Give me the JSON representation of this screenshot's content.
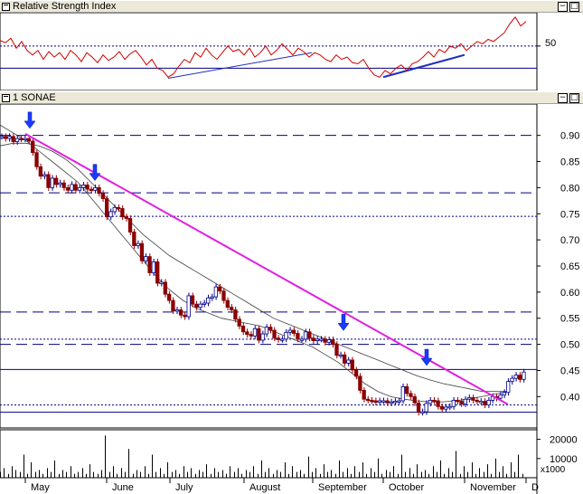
{
  "rsi_panel": {
    "title": "Relative Strength Index",
    "level_label": "50"
  },
  "price_panel": {
    "title": "1 SONAE",
    "volume_scale_label": "x1000"
  },
  "window_buttons": {
    "minimize": "−",
    "maximize": "□"
  },
  "colors": {
    "candle_up": "#00008b",
    "candle_down": "#8b0000",
    "trendline": "#e020e0",
    "signal_arrow": "#1a3cff",
    "rsi_line": "#d00000",
    "rsi_trendline": "#1f2fbf",
    "moving_average": "#404040",
    "level_line": "#000080",
    "volume_bar": "#000000"
  },
  "chart_data": [
    {
      "type": "line",
      "name": "rsi",
      "title": "Relative Strength Index",
      "ylim": [
        10,
        80
      ],
      "level_lines": [
        50,
        30
      ],
      "x": [
        0,
        6,
        12,
        18,
        24,
        30,
        36,
        42,
        48,
        54,
        60,
        66,
        72,
        78,
        84,
        90,
        96,
        102,
        108,
        114,
        120,
        126,
        132,
        138,
        144,
        150,
        156,
        162,
        168,
        174,
        180,
        186,
        192,
        198,
        204,
        210,
        216,
        222,
        228,
        234,
        240,
        246,
        252,
        258,
        264,
        270,
        276,
        282,
        288,
        294,
        300,
        306,
        312,
        318,
        324,
        330,
        336,
        342,
        348,
        354,
        360,
        366,
        372,
        378,
        384,
        390,
        396,
        402,
        408,
        414,
        420,
        426,
        432,
        438,
        444,
        450,
        456,
        462,
        468,
        474,
        480,
        486,
        492,
        498,
        504,
        510,
        516,
        522,
        528,
        534,
        540,
        546,
        552,
        558,
        564,
        570,
        576,
        582
      ],
      "values": [
        55,
        53,
        57,
        48,
        54,
        46,
        42,
        46,
        38,
        45,
        40,
        44,
        38,
        46,
        42,
        36,
        44,
        40,
        35,
        42,
        37,
        40,
        45,
        38,
        43,
        46,
        40,
        33,
        38,
        30,
        28,
        22,
        25,
        32,
        38,
        35,
        44,
        40,
        48,
        42,
        38,
        44,
        50,
        45,
        47,
        42,
        48,
        40,
        44,
        50,
        42,
        46,
        52,
        47,
        42,
        48,
        45,
        40,
        44,
        42,
        38,
        36,
        42,
        38,
        40,
        35,
        34,
        38,
        30,
        24,
        22,
        28,
        25,
        30,
        33,
        28,
        34,
        36,
        40,
        45,
        40,
        47,
        44,
        50,
        48,
        52,
        46,
        50,
        54,
        52,
        56,
        54,
        58,
        62,
        70,
        76,
        68,
        72
      ],
      "trendlines": [
        {
          "from": [
            186,
            21
          ],
          "to": [
            345,
            44
          ]
        },
        {
          "from": [
            424,
            22
          ],
          "to": [
            514,
            42
          ]
        }
      ]
    },
    {
      "type": "candlestick",
      "name": "1 SONAE",
      "title": "1 SONAE",
      "ylim": [
        0.34,
        0.96
      ],
      "yticks": [
        0.9,
        0.85,
        0.8,
        0.75,
        0.7,
        0.65,
        0.6,
        0.55,
        0.5,
        0.45,
        0.4
      ],
      "xlabels": [
        "May",
        "June",
        "July",
        "August",
        "September",
        "October",
        "November",
        "D"
      ],
      "month_x": [
        28,
        118,
        188,
        270,
        346,
        424,
        514,
        582
      ],
      "close": [
        0.898,
        0.894,
        0.898,
        0.888,
        0.894,
        0.893,
        0.894,
        0.889,
        0.867,
        0.84,
        0.822,
        0.825,
        0.8,
        0.818,
        0.806,
        0.809,
        0.8,
        0.795,
        0.806,
        0.795,
        0.8,
        0.805,
        0.797,
        0.795,
        0.8,
        0.789,
        0.779,
        0.744,
        0.754,
        0.762,
        0.76,
        0.744,
        0.741,
        0.715,
        0.689,
        0.693,
        0.66,
        0.668,
        0.637,
        0.658,
        0.617,
        0.619,
        0.596,
        0.584,
        0.564,
        0.566,
        0.556,
        0.553,
        0.593,
        0.577,
        0.571,
        0.577,
        0.579,
        0.589,
        0.591,
        0.61,
        0.602,
        0.584,
        0.571,
        0.566,
        0.548,
        0.535,
        0.524,
        0.519,
        0.516,
        0.53,
        0.508,
        0.52,
        0.533,
        0.527,
        0.512,
        0.509,
        0.51,
        0.523,
        0.527,
        0.521,
        0.51,
        0.51,
        0.524,
        0.512,
        0.507,
        0.51,
        0.51,
        0.504,
        0.509,
        0.5,
        0.479,
        0.48,
        0.464,
        0.47,
        0.451,
        0.439,
        0.412,
        0.395,
        0.393,
        0.392,
        0.389,
        0.392,
        0.392,
        0.388,
        0.39,
        0.391,
        0.392,
        0.419,
        0.406,
        0.4,
        0.388,
        0.37,
        0.371,
        0.387,
        0.393,
        0.392,
        0.381,
        0.376,
        0.38,
        0.381,
        0.393,
        0.391,
        0.386,
        0.395,
        0.398,
        0.393,
        0.391,
        0.391,
        0.384,
        0.393,
        0.4,
        0.397,
        0.403,
        0.408,
        0.429,
        0.435,
        0.441,
        0.433,
        0.447
      ],
      "moving_averages": [
        {
          "name": "MA short",
          "values": [
            0.92,
            0.905,
            0.89,
            0.87,
            0.85,
            0.83,
            0.81,
            0.78,
            0.75,
            0.72,
            0.69,
            0.66,
            0.63,
            0.605,
            0.585,
            0.57,
            0.56,
            0.55,
            0.545,
            0.54,
            0.535,
            0.525,
            0.515,
            0.505,
            0.495,
            0.48,
            0.465,
            0.445,
            0.425,
            0.41,
            0.4,
            0.395,
            0.392,
            0.39,
            0.39,
            0.392,
            0.396,
            0.4,
            0.405,
            0.41
          ]
        },
        {
          "name": "MA long",
          "values": [
            0.88,
            0.885,
            0.885,
            0.88,
            0.87,
            0.855,
            0.835,
            0.81,
            0.785,
            0.76,
            0.735,
            0.71,
            0.69,
            0.67,
            0.655,
            0.64,
            0.625,
            0.61,
            0.595,
            0.58,
            0.565,
            0.55,
            0.54,
            0.53,
            0.52,
            0.51,
            0.5,
            0.49,
            0.48,
            0.47,
            0.46,
            0.45,
            0.44,
            0.432,
            0.425,
            0.42,
            0.415,
            0.41,
            0.41,
            0.41
          ]
        }
      ],
      "level_lines": [
        {
          "value": 0.9,
          "style": "dashed"
        },
        {
          "value": 0.79,
          "style": "dashed"
        },
        {
          "value": 0.745,
          "style": "dotted"
        },
        {
          "value": 0.562,
          "style": "dashed"
        },
        {
          "value": 0.51,
          "style": "dotted"
        },
        {
          "value": 0.5,
          "style": "dashed"
        },
        {
          "value": 0.452,
          "style": "solid"
        },
        {
          "value": 0.384,
          "style": "dotted"
        },
        {
          "value": 0.37,
          "style": "solid"
        }
      ],
      "trendline": {
        "from": [
          28,
          0.903
        ],
        "to": [
          562,
          0.385
        ]
      },
      "signal_arrows": [
        {
          "x": 33,
          "price": 0.91
        },
        {
          "x": 105,
          "price": 0.81
        },
        {
          "x": 380,
          "price": 0.523
        },
        {
          "x": 472,
          "price": 0.456
        }
      ]
    },
    {
      "type": "bar",
      "name": "volume",
      "unit": "x1000",
      "yticks": [
        20000,
        10000
      ],
      "ylim": [
        0,
        25000
      ],
      "values": [
        3000,
        5000,
        2000,
        6000,
        4000,
        3000,
        12000,
        2000,
        8000,
        3000,
        4000,
        2000,
        5000,
        3000,
        9000,
        2000,
        4000,
        3000,
        6000,
        2000,
        3000,
        5000,
        2000,
        7000,
        3000,
        2000,
        4000,
        22000,
        3000,
        6000,
        2000,
        5000,
        3000,
        15000,
        2000,
        4000,
        3000,
        6000,
        2000,
        12000,
        3000,
        5000,
        2000,
        8000,
        3000,
        4000,
        2000,
        6000,
        3000,
        5000,
        2000,
        4000,
        3000,
        7000,
        2000,
        5000,
        3000,
        4000,
        2000,
        6000,
        3000,
        5000,
        2000,
        4000,
        3000,
        6000,
        2000,
        9000,
        3000,
        5000,
        2000,
        4000,
        3000,
        8000,
        2000,
        6000,
        3000,
        4000,
        2000,
        11000,
        3000,
        5000,
        2000,
        7000,
        3000,
        4000,
        2000,
        9000,
        3000,
        5000,
        2000,
        6000,
        3000,
        8000,
        2000,
        5000,
        3000,
        10000,
        2000,
        4000,
        3000,
        6000,
        2000,
        12000,
        3000,
        5000,
        2000,
        7000,
        3000,
        4000,
        2000,
        6000,
        3000,
        9000,
        2000,
        5000,
        3000,
        14000,
        2000,
        6000,
        3000,
        8000,
        2000,
        5000,
        3000,
        7000,
        2000,
        10000,
        3000,
        6000,
        2000,
        8000,
        3000,
        12000,
        2000
      ]
    }
  ]
}
